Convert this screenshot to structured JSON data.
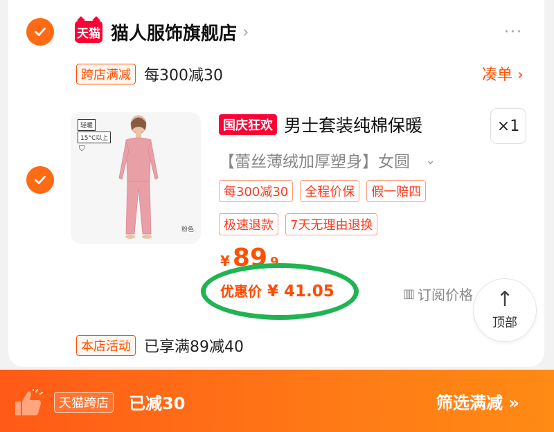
{
  "store": {
    "logo_text": "天猫",
    "name": "猫人服饰旗舰店",
    "chevron": "›",
    "more": "···"
  },
  "promo": {
    "tag": "跨店满减",
    "text": "每300减30",
    "link": "凑单 ›"
  },
  "product": {
    "badge": "国庆狂欢",
    "title": "男士套装纯棉保暖",
    "quantity": "×1",
    "sku": "【蕾丝薄绒加厚塑身】女圆",
    "sku_chevron": "⌄",
    "thumb_labels": [
      "轻暖",
      "15°C以上",
      "粉色"
    ],
    "tags_row1": [
      "每300减30",
      "全程价保",
      "假一赔四"
    ],
    "tags_row2": [
      "极速退款",
      "7天无理由退换"
    ],
    "price_symbol": "¥",
    "price_int": "89",
    "price_dec": "9",
    "deal_label": "优惠价",
    "deal_value": "¥ 41.05",
    "subscribe": "订阅价格"
  },
  "top_button": {
    "arrow": "↑",
    "label": "顶部"
  },
  "activity": {
    "tag": "本店活动",
    "text": "已享满89减40"
  },
  "bottom_bar": {
    "badge": "天猫跨店",
    "text": "已减30",
    "right": "筛选满减 »"
  },
  "colors": {
    "accent": "#ff5000",
    "check": "#ff6a14",
    "tmall_red": "#ff0036",
    "highlight_circle": "#1fb451"
  }
}
